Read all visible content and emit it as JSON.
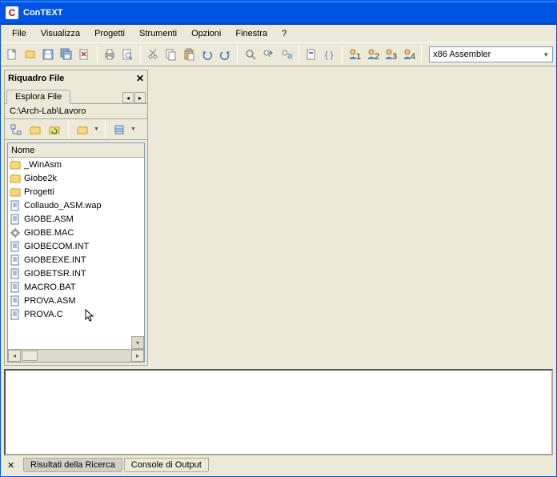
{
  "app": {
    "title": "ConTEXT",
    "icon_letter": "C"
  },
  "menu": {
    "items": [
      "File",
      "Visualizza",
      "Progetti",
      "Strumenti",
      "Opzioni",
      "Finestra",
      "?"
    ]
  },
  "toolbar": {
    "icons": [
      "new",
      "open",
      "save",
      "saveall",
      "close",
      "|",
      "print",
      "preview",
      "|",
      "cut",
      "copy",
      "paste",
      "undo",
      "redo",
      "|",
      "find",
      "findnext",
      "replace",
      "|",
      "bookmark",
      "bracket",
      "|",
      "user1",
      "user2",
      "user3",
      "user4"
    ],
    "syntax_value": "x86 Assembler"
  },
  "file_panel": {
    "title": "Riquadro File",
    "tab_label": "Esplora File",
    "path": "C:\\Arch-Lab\\Lavoro",
    "column_header": "Nome",
    "items": [
      {
        "icon": "folder",
        "name": "_WinAsm"
      },
      {
        "icon": "folder",
        "name": "Giobe2k"
      },
      {
        "icon": "folder",
        "name": "Progetti"
      },
      {
        "icon": "doc",
        "name": "Collaudo_ASM.wap"
      },
      {
        "icon": "doc",
        "name": "GIOBE.ASM"
      },
      {
        "icon": "gear",
        "name": "GIOBE.MAC"
      },
      {
        "icon": "doc",
        "name": "GIOBECOM.INT"
      },
      {
        "icon": "doc",
        "name": "GIOBEEXE.INT"
      },
      {
        "icon": "doc",
        "name": "GIOBETSR.INT"
      },
      {
        "icon": "doc",
        "name": "MACRO.BAT"
      },
      {
        "icon": "doc",
        "name": "PROVA.ASM"
      },
      {
        "icon": "doc",
        "name": "PROVA.C"
      }
    ]
  },
  "bottom": {
    "tabs": [
      "Risultati della Ricerca",
      "Console di Output"
    ],
    "active_tab": 0
  }
}
